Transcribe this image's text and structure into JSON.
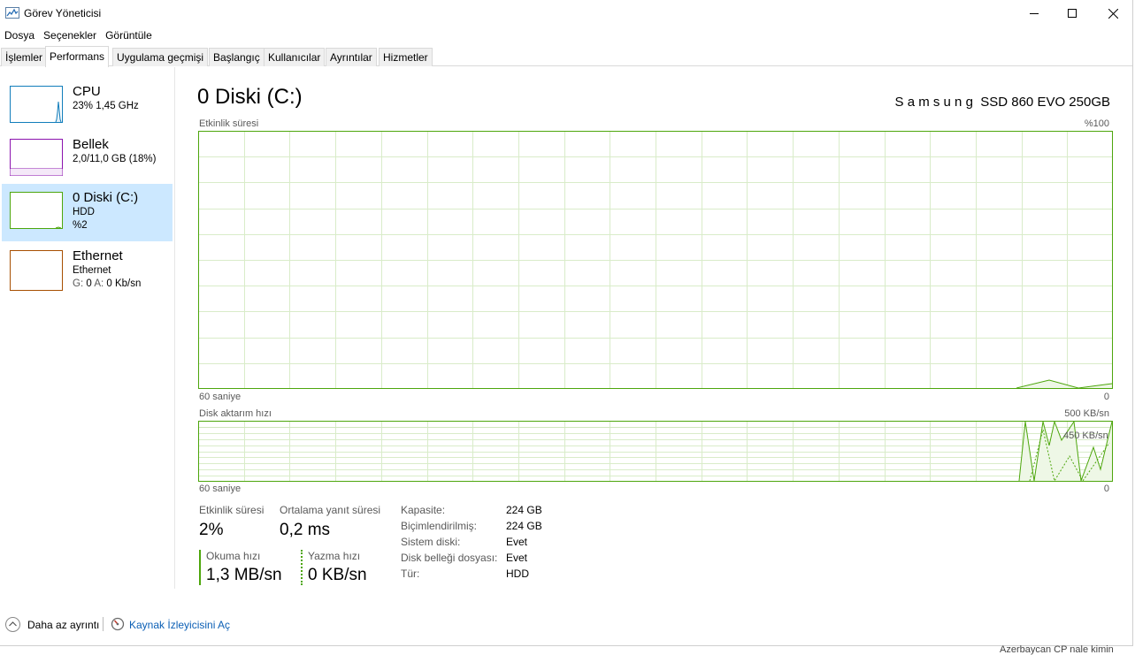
{
  "window": {
    "title": "Görev Yöneticisi"
  },
  "menu": [
    "Dosya",
    "Seçenekler",
    "Görüntüle"
  ],
  "tabs": [
    "İşlemler",
    "Performans",
    "Uygulama geçmişi",
    "Başlangıç",
    "Kullanıcılar",
    "Ayrıntılar",
    "Hizmetler"
  ],
  "active_tab": "Performans",
  "sidebar": {
    "items": [
      {
        "name": "CPU",
        "sub1": "23%  1,45 GHz",
        "sub2": "",
        "color": "#117dbb"
      },
      {
        "name": "Bellek",
        "sub1": "2,0/11,0 GB (18%)",
        "sub2": "",
        "color": "#8b12ae"
      },
      {
        "name": "0 Diski (C:)",
        "sub1": "HDD",
        "sub2": "%2",
        "color": "#4da60c"
      },
      {
        "name": "Ethernet",
        "sub1": "Ethernet",
        "sub2_prefix_g": "G:",
        "sub2_val_g": "0",
        "sub2_prefix_a": "A:",
        "sub2_val_a": "0 Kb/sn",
        "color": "#a74f01"
      }
    ],
    "selected_index": 2
  },
  "main": {
    "title": "0 Diski (C:)",
    "device": "S a m s u n g  SSD 860 EVO 250GB",
    "graph1": {
      "label": "Etkinlik süresi",
      "max_label": "%100",
      "time_label": "60 saniye",
      "min_label": "0"
    },
    "graph2": {
      "label": "Disk aktarım hızı",
      "max_label": "500 KB/sn",
      "mid_label": "450 KB/sn",
      "time_label": "60 saniye",
      "min_label": "0"
    },
    "stats": {
      "activity_label": "Etkinlik süresi",
      "activity_value": "2%",
      "response_label": "Ortalama yanıt süresi",
      "response_value": "0,2 ms",
      "read_label": "Okuma hızı",
      "read_value": "1,3 MB/sn",
      "write_label": "Yazma hızı",
      "write_value": "0 KB/sn"
    },
    "info": [
      {
        "label": "Kapasite:",
        "value": "224 GB"
      },
      {
        "label": "Biçimlendirilmiş:",
        "value": "224 GB"
      },
      {
        "label": "Sistem diski:",
        "value": "Evet"
      },
      {
        "label": "Disk belleği dosyası:",
        "value": "Evet"
      },
      {
        "label": "Tür:",
        "value": "HDD"
      }
    ]
  },
  "footer": {
    "fewer_details": "Daha az ayrıntı",
    "resource_monitor": "Kaynak İzleyicisini Aç"
  },
  "colors": {
    "disk_green": "#4da60c",
    "grid_green": "#d9ecc9",
    "cpu_blue": "#117dbb",
    "memory_purple": "#8b12ae",
    "ethernet_brown": "#a74f01",
    "selected_bg": "#cce8ff",
    "link_blue": "#0b5fb5"
  },
  "behind_window_text": "Azerbaycan CP nale kimin"
}
